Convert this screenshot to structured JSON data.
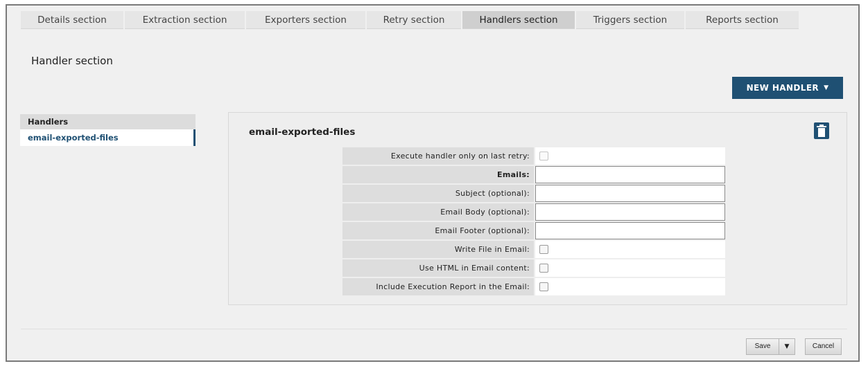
{
  "tabs": [
    {
      "label": "Details section"
    },
    {
      "label": "Extraction section"
    },
    {
      "label": "Exporters section"
    },
    {
      "label": "Retry section"
    },
    {
      "label": "Handlers section",
      "active": true
    },
    {
      "label": "Triggers section"
    },
    {
      "label": "Reports section"
    }
  ],
  "page": {
    "title": "Handler section",
    "new_handler_label": "NEW HANDLER",
    "new_handler_caret": "▼"
  },
  "sidebar": {
    "header": "Handlers",
    "items": [
      {
        "label": "email-exported-files"
      }
    ]
  },
  "handler": {
    "name": "email-exported-files",
    "fields": [
      {
        "label": "Execute handler only on last retry:",
        "type": "checkbox",
        "checked": false,
        "disabled": true
      },
      {
        "label": "Emails:",
        "type": "text",
        "value": "",
        "required": true
      },
      {
        "label": "Subject (optional):",
        "type": "text",
        "value": ""
      },
      {
        "label": "Email Body (optional):",
        "type": "text",
        "value": ""
      },
      {
        "label": "Email Footer (optional):",
        "type": "text",
        "value": ""
      },
      {
        "label": "Write File in Email:",
        "type": "checkbox",
        "checked": false
      },
      {
        "label": "Use HTML in Email content:",
        "type": "checkbox",
        "checked": false
      },
      {
        "label": "Include Execution Report in the Email:",
        "type": "checkbox",
        "checked": false
      }
    ]
  },
  "footer": {
    "save_label": "Save",
    "save_dropdown": "▼",
    "cancel_label": "Cancel"
  },
  "colors": {
    "accent": "#1f5073",
    "background": "#f0f0f0"
  }
}
